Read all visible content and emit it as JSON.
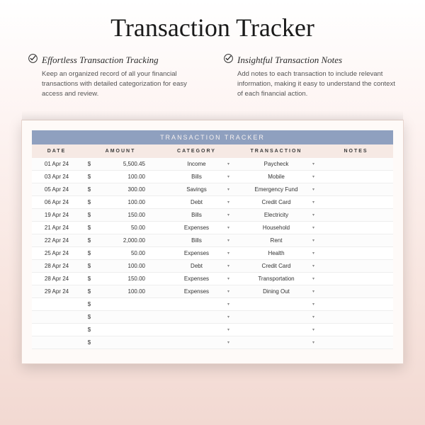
{
  "title": "Transaction Tracker",
  "features": [
    {
      "title": "Effortless Transaction Tracking",
      "desc": "Keep an organized record of all your financial transactions with detailed categorization for easy access and review."
    },
    {
      "title": "Insightful Transaction Notes",
      "desc": "Add notes to each transaction to include relevant information, making it easy to understand the context of each financial action."
    }
  ],
  "tracker": {
    "banner": "TRANSACTION TRACKER",
    "columns": [
      "DATE",
      "AMOUNT",
      "CATEGORY",
      "TRANSACTION",
      "NOTES"
    ],
    "currency": "$",
    "rows": [
      {
        "date": "01 Apr 24",
        "amount": "5,500.45",
        "category": "Income",
        "transaction": "Paycheck",
        "notes": ""
      },
      {
        "date": "03 Apr 24",
        "amount": "100.00",
        "category": "Bills",
        "transaction": "Mobile",
        "notes": ""
      },
      {
        "date": "05 Apr 24",
        "amount": "300.00",
        "category": "Savings",
        "transaction": "Emergency Fund",
        "notes": ""
      },
      {
        "date": "06 Apr 24",
        "amount": "100.00",
        "category": "Debt",
        "transaction": "Credit Card",
        "notes": ""
      },
      {
        "date": "19 Apr 24",
        "amount": "150.00",
        "category": "Bills",
        "transaction": "Electricity",
        "notes": ""
      },
      {
        "date": "21 Apr 24",
        "amount": "50.00",
        "category": "Expenses",
        "transaction": "Household",
        "notes": ""
      },
      {
        "date": "22 Apr 24",
        "amount": "2,000.00",
        "category": "Bills",
        "transaction": "Rent",
        "notes": ""
      },
      {
        "date": "25 Apr 24",
        "amount": "50.00",
        "category": "Expenses",
        "transaction": "Health",
        "notes": ""
      },
      {
        "date": "28 Apr 24",
        "amount": "100.00",
        "category": "Debt",
        "transaction": "Credit Card",
        "notes": ""
      },
      {
        "date": "28 Apr 24",
        "amount": "150.00",
        "category": "Expenses",
        "transaction": "Transportation",
        "notes": ""
      },
      {
        "date": "29 Apr 24",
        "amount": "100.00",
        "category": "Expenses",
        "transaction": "Dining Out",
        "notes": ""
      },
      {
        "date": "",
        "amount": "",
        "category": "",
        "transaction": "",
        "notes": ""
      },
      {
        "date": "",
        "amount": "",
        "category": "",
        "transaction": "",
        "notes": ""
      },
      {
        "date": "",
        "amount": "",
        "category": "",
        "transaction": "",
        "notes": ""
      },
      {
        "date": "",
        "amount": "",
        "category": "",
        "transaction": "",
        "notes": ""
      }
    ]
  }
}
